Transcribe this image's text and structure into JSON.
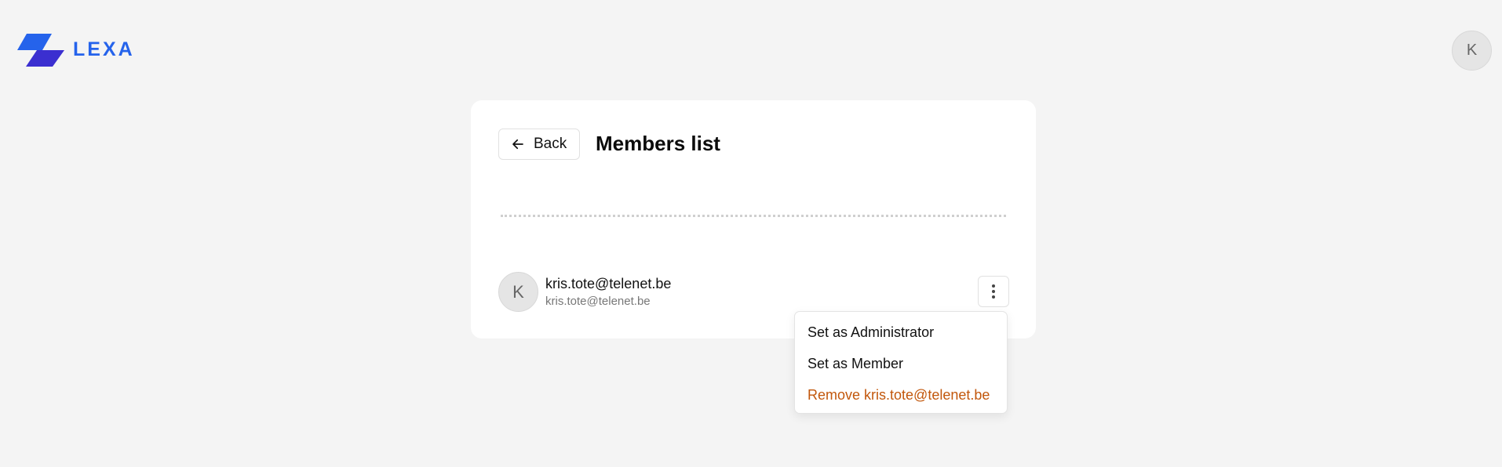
{
  "header": {
    "logo_text": "LEXA",
    "user_avatar_initial": "K"
  },
  "page": {
    "back_label": "Back",
    "title": "Members list"
  },
  "members": [
    {
      "initial": "K",
      "name": "kris.tote@telenet.be",
      "email": "kris.tote@telenet.be"
    }
  ],
  "member_menu": {
    "items": [
      {
        "label": "Set as Administrator"
      },
      {
        "label": "Set as Member"
      },
      {
        "label": "Remove kris.tote@telenet.be"
      }
    ]
  },
  "icons": {
    "logo": "lexa-logo-icon",
    "back": "arrow-left-icon",
    "more": "more-vertical-icon"
  },
  "colors": {
    "brand": "#2563eb",
    "brand_secondary": "#3b2fd0",
    "danger": "#c2570c",
    "background": "#f4f4f4",
    "card": "#ffffff"
  }
}
